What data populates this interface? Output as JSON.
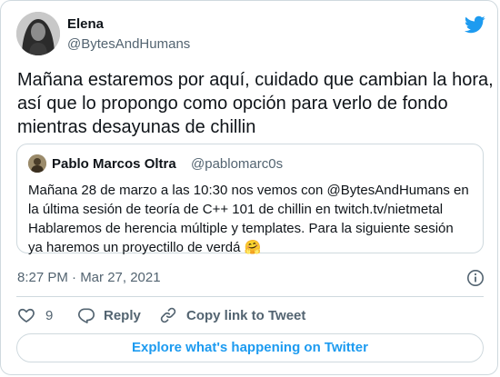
{
  "tweet": {
    "author_name": "Elena",
    "author_handle": "@BytesAndHumans",
    "text_lines": [
      "Mañana estaremos por aquí, cuidado que cambian la hora,",
      "así que lo propongo como opción para verlo de fondo",
      "mientras desayunas de chillin"
    ],
    "timestamp": "8:27 PM · Mar 27, 2021"
  },
  "quoted": {
    "author_name": "Pablo Marcos Oltra",
    "author_handle": "@pablomarc0s",
    "text_lines": [
      "Mañana 28 de marzo a las 10:30 nos vemos con @BytesAndHumans en",
      "la última sesión de teoría de C++ 101 de chillin en twitch.tv/nietmetal",
      "Hablaremos de herencia múltiple y templates. Para la siguiente sesión",
      "ya haremos un proyectillo de verdá 🤗"
    ]
  },
  "actions": {
    "like_count": "9",
    "reply_label": "Reply",
    "copy_link_label": "Copy link to Tweet"
  },
  "explore_label": "Explore what's happening on Twitter",
  "colors": {
    "accent": "#1d9bf0",
    "like": "#536471",
    "text_primary": "#0f1419",
    "text_secondary": "#536471",
    "border": "#cfd9de"
  },
  "icons": [
    "twitter-logo-icon",
    "info-icon",
    "heart-icon",
    "reply-icon",
    "link-icon"
  ]
}
